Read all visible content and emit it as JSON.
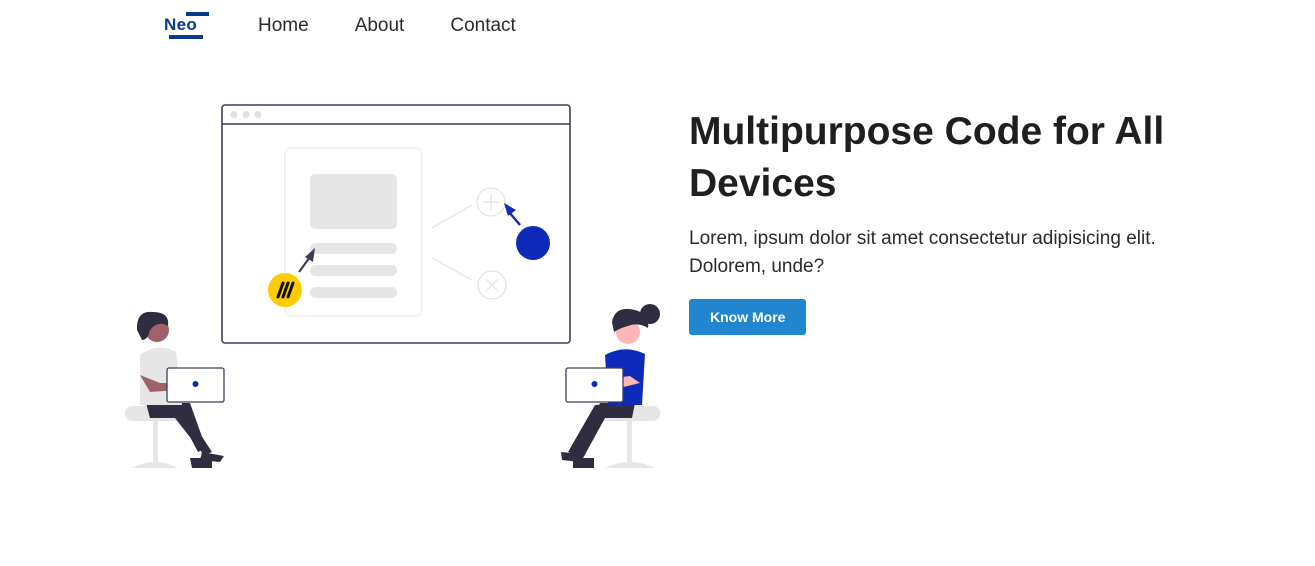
{
  "brand": {
    "logo_text": "Neo",
    "color": "#0b3a8a"
  },
  "nav": {
    "items": [
      {
        "label": "Home"
      },
      {
        "label": "About"
      },
      {
        "label": "Contact"
      }
    ]
  },
  "hero": {
    "title": "Multipurpose Code for All Devices",
    "description": "Lorem, ipsum dolor sit amet consectetur adipisicing elit. Dolorem, unde?",
    "cta_label": "Know More",
    "cta_color": "#2185d0",
    "illustration": {
      "accent_blue": "#0d2bb8",
      "accent_yellow": "#ffcc00",
      "plus_icon": "plus-circle-icon",
      "close_icon": "x-circle-icon"
    }
  }
}
